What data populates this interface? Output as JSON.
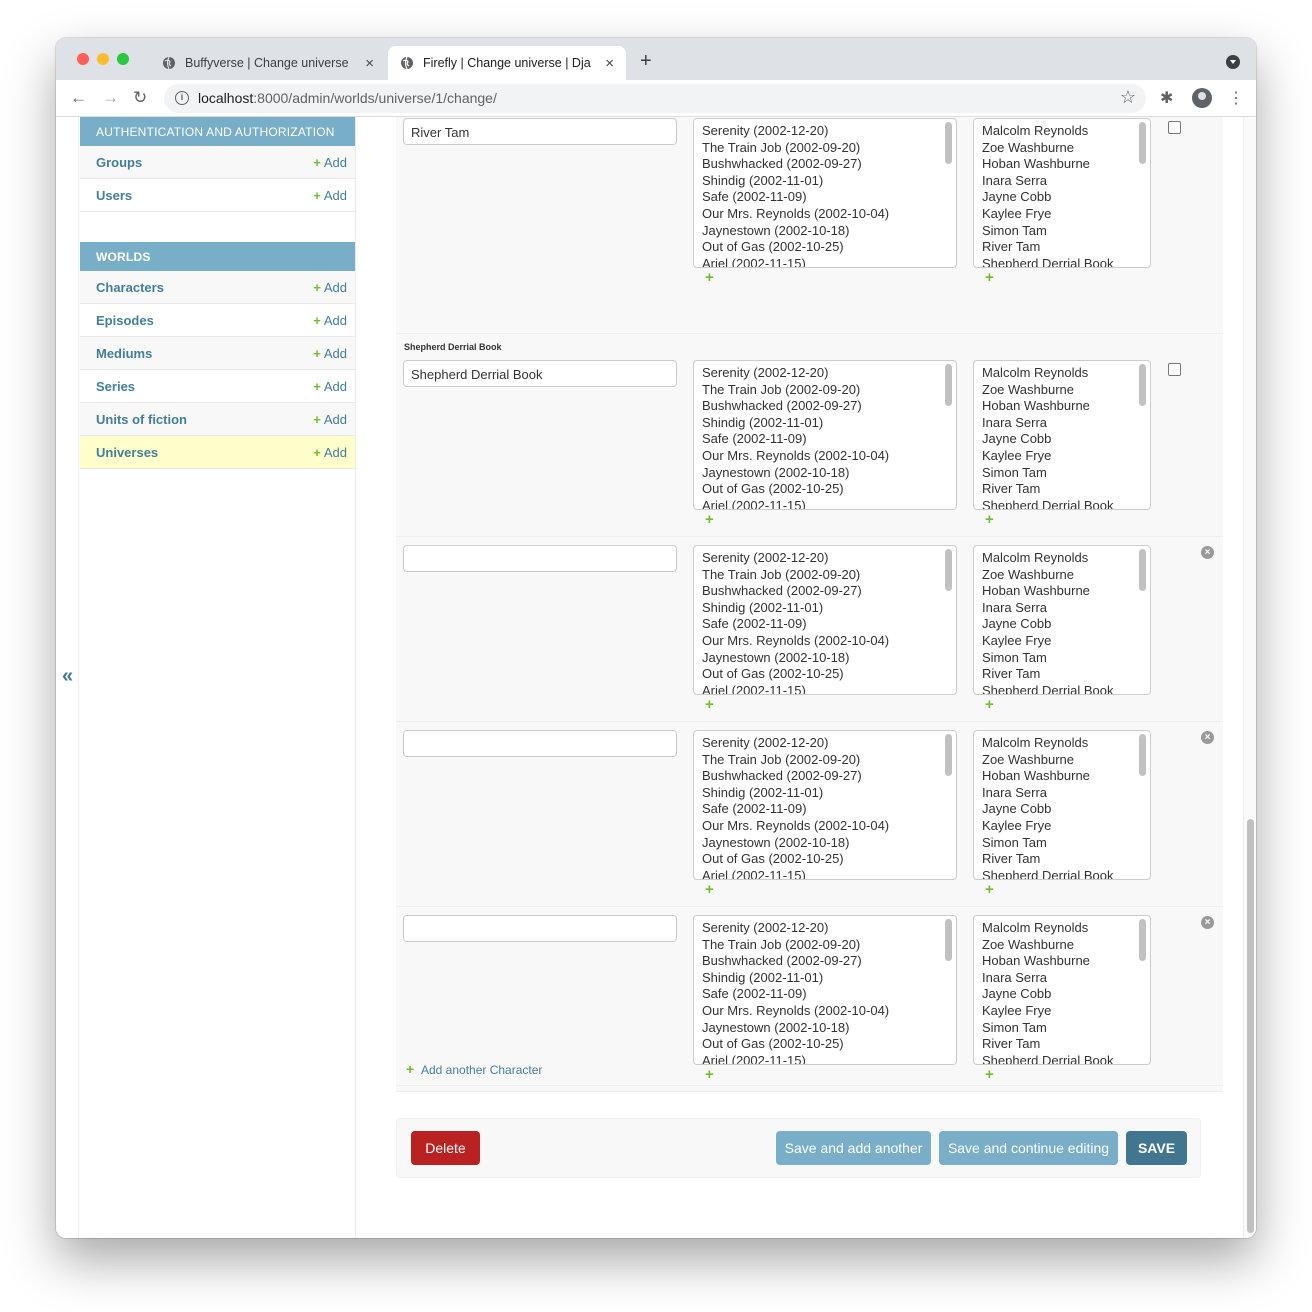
{
  "browser": {
    "tabs": [
      {
        "title": "Buffyverse | Change universe | Django site admin",
        "close": "×"
      },
      {
        "title": "Firefly | Change universe | Django site admin",
        "close": "×"
      }
    ],
    "new_tab": "+",
    "url_host": "localhost",
    "url_path": ":8000/admin/worlds/universe/1/change/",
    "back": "←",
    "forward": "→",
    "reload": "↻",
    "bookmark_star": "☆",
    "extensions": "✱",
    "menu": "⋮"
  },
  "sidebar": {
    "collapse_toggle": "«",
    "sections": [
      {
        "caption": "AUTHENTICATION AND AUTHORIZATION",
        "items": [
          {
            "label": "Groups",
            "add": "Add"
          },
          {
            "label": "Users",
            "add": "Add"
          }
        ]
      },
      {
        "caption": "WORLDS",
        "items": [
          {
            "label": "Characters",
            "add": "Add"
          },
          {
            "label": "Episodes",
            "add": "Add"
          },
          {
            "label": "Mediums",
            "add": "Add"
          },
          {
            "label": "Series",
            "add": "Add"
          },
          {
            "label": "Units of fiction",
            "add": "Add"
          },
          {
            "label": "Universes",
            "add": "Add"
          }
        ]
      }
    ]
  },
  "episode_options": [
    "Serenity (2002-12-20)",
    "The Train Job (2002-09-20)",
    "Bushwhacked (2002-09-27)",
    "Shindig (2002-11-01)",
    "Safe (2002-11-09)",
    "Our Mrs. Reynolds (2002-10-04)",
    "Jaynestown (2002-10-18)",
    "Out of Gas (2002-10-25)",
    "Ariel (2002-11-15)"
  ],
  "character_options": [
    "Malcolm Reynolds",
    "Zoe Washburne",
    "Hoban Washburne",
    "Inara Serra",
    "Jayne Cobb",
    "Kaylee Frye",
    "Simon Tam",
    "River Tam",
    "Shepherd Derrial Book"
  ],
  "inline_rows": [
    {
      "label": "",
      "name": "River Tam"
    },
    {
      "label": "Shepherd Derrial Book",
      "name": "Shepherd Derrial Book"
    },
    {
      "label": "",
      "name": ""
    },
    {
      "label": "",
      "name": ""
    },
    {
      "label": "",
      "name": ""
    }
  ],
  "add_plus": "+",
  "remove_icon": "×",
  "add_another": "Add another Character",
  "buttons": {
    "delete": "Delete",
    "save_add_another": "Save and add another",
    "save_continue": "Save and continue editing",
    "save": "SAVE"
  }
}
